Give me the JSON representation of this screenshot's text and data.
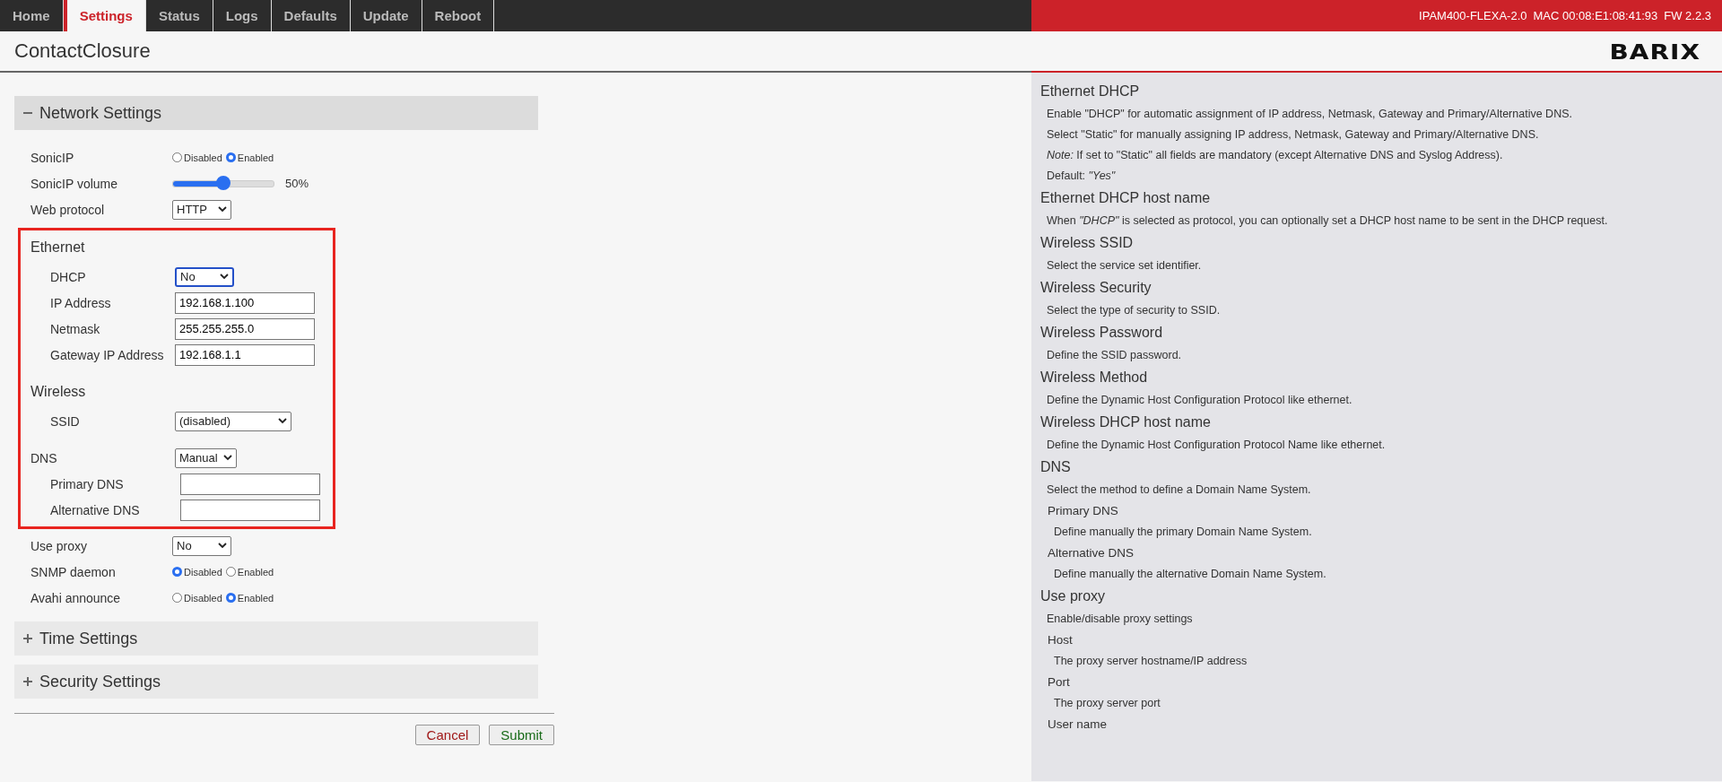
{
  "nav": {
    "tabs": [
      {
        "label": "Home",
        "selected": false
      },
      {
        "label": "Settings",
        "selected": true
      },
      {
        "label": "Status",
        "selected": false
      },
      {
        "label": "Logs",
        "selected": false
      },
      {
        "label": "Defaults",
        "selected": false
      },
      {
        "label": "Update",
        "selected": false
      },
      {
        "label": "Reboot",
        "selected": false
      }
    ],
    "device": {
      "model": "IPAM400-FLEXA-2.0",
      "mac": "MAC 00:08:E1:08:41:93",
      "firmware": "FW 2.2.3"
    }
  },
  "header": {
    "title": "ContactClosure",
    "logo": "BARIX"
  },
  "sections": [
    {
      "title": "Network Settings",
      "expanded": true,
      "rows": [
        {
          "kind": "radio",
          "label": "SonicIP",
          "options": [
            {
              "label": "Disabled",
              "selected": false
            },
            {
              "label": "Enabled",
              "selected": true
            }
          ]
        },
        {
          "kind": "slider",
          "label": "SonicIP volume",
          "level": 0.5,
          "reading": "50%"
        },
        {
          "kind": "select",
          "label": "Web protocol",
          "value": "HTTP",
          "focused": false
        },
        {
          "kind": "group",
          "highlighted": true,
          "rows": [
            {
              "kind": "heading",
              "label": "Ethernet",
              "children": [
                {
                  "kind": "select",
                  "label": "DHCP",
                  "value": "No",
                  "focused": true
                },
                {
                  "kind": "text",
                  "label": "IP Address",
                  "value": "192.168.1.100"
                },
                {
                  "kind": "text",
                  "label": "Netmask",
                  "value": "255.255.255.0"
                },
                {
                  "kind": "text",
                  "label": "Gateway IP Address",
                  "value": "192.168.1.1"
                }
              ]
            },
            {
              "kind": "heading",
              "label": "Wireless",
              "children": [
                {
                  "kind": "select",
                  "label": "SSID",
                  "value": "(disabled)",
                  "focused": false,
                  "wide": true
                }
              ]
            },
            {
              "kind": "select",
              "label": "DNS",
              "value": "Manual",
              "focused": false,
              "children": [
                {
                  "kind": "text",
                  "label": "Primary DNS"
                },
                {
                  "kind": "text",
                  "label": "Alternative DNS"
                }
              ]
            }
          ]
        },
        {
          "kind": "select",
          "label": "Use proxy",
          "value": "No",
          "focused": false
        },
        {
          "kind": "radio",
          "label": "SNMP daemon",
          "options": [
            {
              "label": "Disabled",
              "selected": true
            },
            {
              "label": "Enabled",
              "selected": false
            }
          ]
        },
        {
          "kind": "radio",
          "label": "Avahi announce",
          "options": [
            {
              "label": "Disabled",
              "selected": false
            },
            {
              "label": "Enabled",
              "selected": true
            }
          ]
        }
      ]
    },
    {
      "title": "Time Settings",
      "expanded": false
    },
    {
      "title": "Security Settings",
      "expanded": false
    }
  ],
  "buttons": [
    {
      "label": "Cancel",
      "kind": "cancel"
    },
    {
      "label": "Submit",
      "kind": "submit"
    }
  ],
  "help": [
    {
      "kind": "heading",
      "text": "Ethernet DHCP"
    },
    {
      "kind": "text",
      "text": "Enable \"DHCP\" for automatic assignment of IP address, Netmask, Gateway and Primary/Alternative DNS."
    },
    {
      "kind": "text",
      "text": "Select \"Static\" for manually assigning IP address, Netmask, Gateway and Primary/Alternative DNS."
    },
    {
      "kind": "text",
      "text": "*Note:* If set to \"Static\" all fields are mandatory (except Alternative DNS and Syslog Address)."
    },
    {
      "kind": "text",
      "text": "Default: *\"Yes\"*"
    },
    {
      "kind": "heading",
      "text": "Ethernet DHCP host name"
    },
    {
      "kind": "text",
      "text": "When *\"DHCP\"* is selected as protocol, you can optionally set a DHCP host name to be sent in the DHCP request."
    },
    {
      "kind": "heading",
      "text": "Wireless SSID"
    },
    {
      "kind": "text",
      "text": "Select the service set identifier."
    },
    {
      "kind": "heading",
      "text": "Wireless Security"
    },
    {
      "kind": "text",
      "text": "Select the type of security to SSID."
    },
    {
      "kind": "heading",
      "text": "Wireless Password"
    },
    {
      "kind": "text",
      "text": "Define the SSID password."
    },
    {
      "kind": "heading",
      "text": "Wireless Method"
    },
    {
      "kind": "text",
      "text": "Define the Dynamic Host Configuration Protocol like ethernet."
    },
    {
      "kind": "heading",
      "text": "Wireless DHCP host name"
    },
    {
      "kind": "text",
      "text": "Define the Dynamic Host Configuration Protocol Name like ethernet."
    },
    {
      "kind": "heading",
      "text": "DNS"
    },
    {
      "kind": "text",
      "text": "Select the method to define a Domain Name System."
    },
    {
      "kind": "subheading",
      "text": "Primary DNS"
    },
    {
      "kind": "subtext",
      "text": "Define manually the primary Domain Name System."
    },
    {
      "kind": "subheading",
      "text": "Alternative DNS"
    },
    {
      "kind": "subtext",
      "text": "Define manually the alternative Domain Name System."
    },
    {
      "kind": "heading",
      "text": "Use proxy"
    },
    {
      "kind": "text",
      "text": "Enable/disable proxy settings"
    },
    {
      "kind": "subheading",
      "text": "Host"
    },
    {
      "kind": "subtext",
      "text": "The proxy server hostname/IP address"
    },
    {
      "kind": "subheading",
      "text": "Port"
    },
    {
      "kind": "subtext",
      "text": "The proxy server port"
    },
    {
      "kind": "subheading",
      "text": "User name"
    }
  ]
}
